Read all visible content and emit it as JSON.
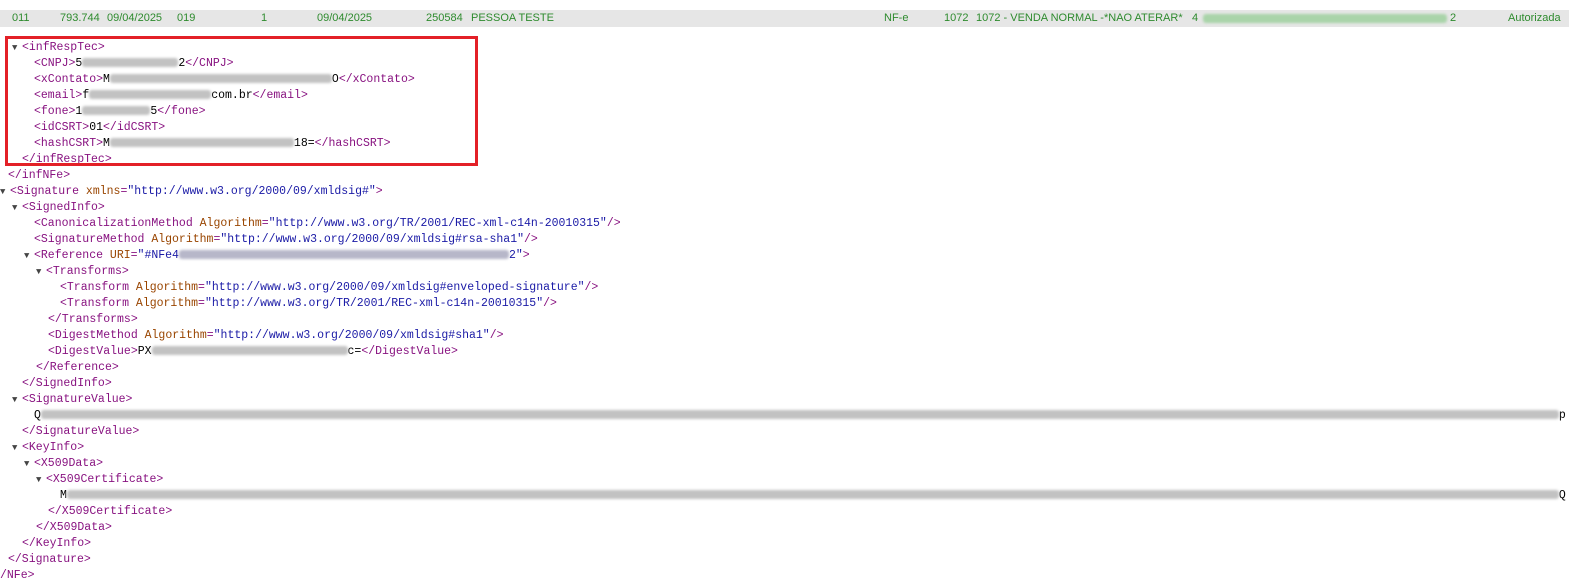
{
  "top_row": {
    "col1": "011",
    "col2": "793.744",
    "col3": "09/04/2025",
    "col4": "019",
    "col5": "1",
    "col6": "09/04/2025",
    "col7": "250584",
    "col8": "PESSOA TESTE",
    "col9": "NF-e",
    "col10": "1072",
    "col11": "1072 - VENDA NORMAL -*NAO ATERAR*",
    "col12_start": "4",
    "col12_end": "2",
    "status": "Autorizada",
    "text_color": "#2e8b2e",
    "background": "#e6e6e6"
  },
  "xml": {
    "toggle_glyph": "▼",
    "lines": {
      "infresptec_open": "<infRespTec>",
      "cnpj_open": "<CNPJ>",
      "cnpj_start": "5",
      "cnpj_end": "2",
      "cnpj_close": "</CNPJ>",
      "xcontato_open": "<xContato>",
      "xcontato_start": "M",
      "xcontato_end": "O",
      "xcontato_close": "</xContato>",
      "email_open": "<email>",
      "email_start": "f",
      "email_end": "com.br",
      "email_close": "</email>",
      "fone_open": "<fone>",
      "fone_start": "1",
      "fone_end": "5",
      "fone_close": "</fone>",
      "idcsrt_open": "<idCSRT>",
      "idcsrt_value": "01",
      "idcsrt_close": "</idCSRT>",
      "hashcsrt_open": "<hashCSRT>",
      "hashcsrt_start": "M",
      "hashcsrt_end": "18=",
      "hashcsrt_close": "</hashCSRT>",
      "infresptec_close": "</infRespTec>",
      "infnfe_close": "</infNFe>",
      "signature_open": "<Signature",
      "attr_xmlns": "xmlns",
      "val_xmlns": "\"http://www.w3.org/2000/09/xmldsig#\"",
      "gt": ">",
      "signedinfo_open": "<SignedInfo>",
      "canon_open": "<CanonicalizationMethod",
      "attr_algorithm": "Algorithm",
      "val_c14n": "\"http://www.w3.org/TR/2001/REC-xml-c14n-20010315\"",
      "selfclose": "/>",
      "sigmethod_open": "<SignatureMethod",
      "val_rsasha1": "\"http://www.w3.org/2000/09/xmldsig#rsa-sha1\"",
      "reference_open": "<Reference",
      "attr_uri": "URI",
      "val_uri_start": "\"#NFe4",
      "val_uri_end": "2\"",
      "transforms_open": "<Transforms>",
      "transform_open": "<Transform",
      "val_enveloped": "\"http://www.w3.org/2000/09/xmldsig#enveloped-signature\"",
      "transforms_close": "</Transforms>",
      "digestmethod_open": "<DigestMethod",
      "val_sha1": "\"http://www.w3.org/2000/09/xmldsig#sha1\"",
      "digestvalue_open": "<DigestValue>",
      "digestvalue_start": "PX",
      "digestvalue_end": "c=",
      "digestvalue_close": "</DigestValue>",
      "reference_close": "</Reference>",
      "signedinfo_close": "</SignedInfo>",
      "signaturevalue_open": "<SignatureValue>",
      "signaturevalue_start": "Q",
      "signaturevalue_end": "p",
      "signaturevalue_close": "</SignatureValue>",
      "keyinfo_open": "<KeyInfo>",
      "x509data_open": "<X509Data>",
      "x509cert_open": "<X509Certificate>",
      "x509cert_start": "M",
      "x509cert_end": "Q",
      "x509cert_close": "</X509Certificate>",
      "x509data_close": "</X509Data>",
      "keyinfo_close": "</KeyInfo>",
      "signature_close": "</Signature>",
      "nfe_close": "/NFe>"
    }
  },
  "colors": {
    "tag": "#881280",
    "attr_name": "#994500",
    "attr_value": "#1a1aa6",
    "text": "#000000",
    "highlight_border": "#e32027"
  }
}
